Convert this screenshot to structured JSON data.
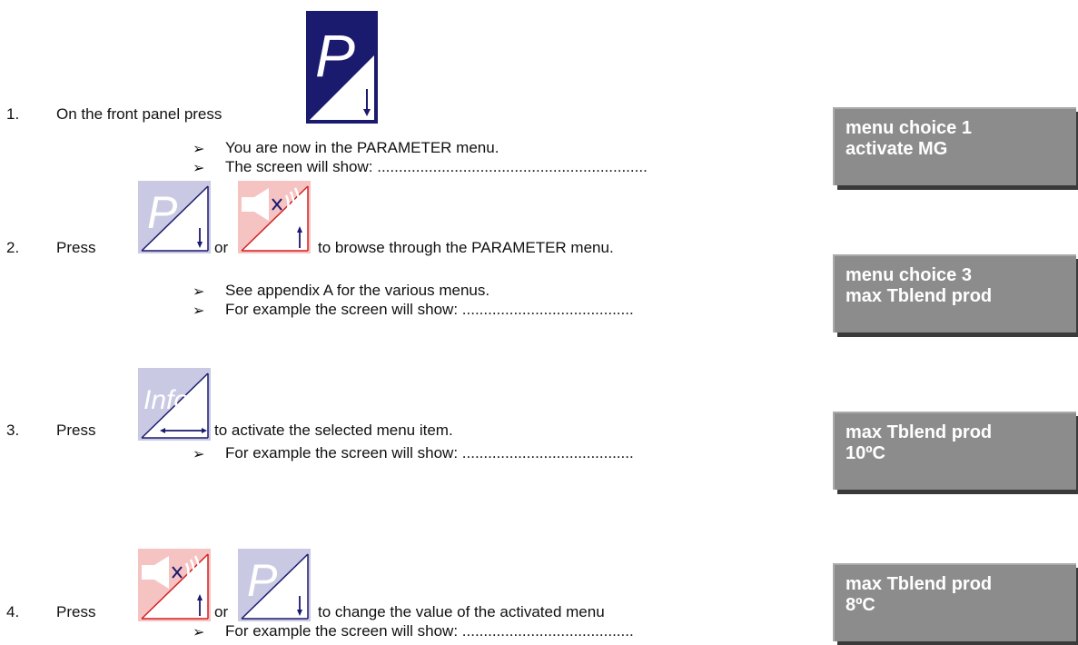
{
  "steps": [
    {
      "number": "1.",
      "before": "On the front panel press",
      "after": "",
      "sub": [
        {
          "text": "You are now in the PARAMETER menu."
        },
        {
          "text": "The screen will show: ..............................................................."
        }
      ],
      "screen": {
        "line1": "menu choice 1",
        "line2": "activate MG"
      }
    },
    {
      "number": "2.",
      "before": "Press",
      "or": "or",
      "after": "to browse through the PARAMETER menu.",
      "sub": [
        {
          "text": "See appendix A for the various menus."
        },
        {
          "text": "For example the screen will show: ........................................"
        }
      ],
      "screen": {
        "line1": "menu choice 3",
        "line2": "max Tblend prod"
      }
    },
    {
      "number": "3.",
      "before": "Press",
      "after": "to activate the selected menu item.",
      "sub": [
        {
          "text": "For example the screen will show: ........................................"
        }
      ],
      "screen": {
        "line1": "max Tblend prod",
        "line2": "10ºC"
      }
    },
    {
      "number": "4.",
      "before": "Press",
      "or": "or",
      "after": "to change the value of the activated menu",
      "sub": [
        {
          "text": "For example the screen will show: ........................................"
        }
      ],
      "screen": {
        "line1": "max Tblend prod",
        "line2": "8ºC"
      }
    }
  ],
  "icons": {
    "bullet": "arrowhead-bullet-icon",
    "p_down": "parameter-down-button-icon",
    "mute_up": "mute-up-button-icon",
    "info_enter": "info-enter-button-icon"
  },
  "colors": {
    "p_dark": "#1a1a6e",
    "p_light": "#c9c9e3",
    "mute_light": "#f6c3c3",
    "screen_bg": "#8c8c8c"
  },
  "info_label": "Info",
  "p_label": "P"
}
